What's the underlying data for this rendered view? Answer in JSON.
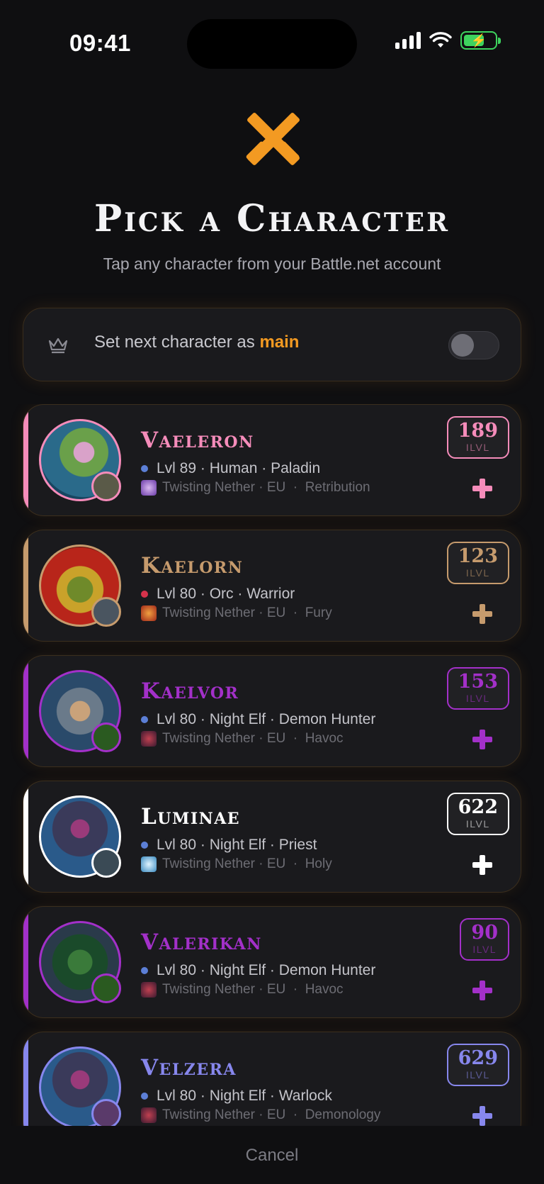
{
  "status_bar": {
    "time": "09:41"
  },
  "header": {
    "title": "Pick a Character",
    "subtitle": "Tap any character from your Battle.net account",
    "icon": "crossed-swords-icon",
    "accent_color": "#f39a22"
  },
  "main_toggle": {
    "label_prefix": "Set next character as",
    "label_highlight": "main",
    "enabled": false
  },
  "characters": [
    {
      "name": "Vaeleron",
      "level_text": "Lvl 89",
      "race": "Human",
      "class": "Paladin",
      "realm": "Twisting Nether",
      "region": "EU",
      "spec": "Retribution",
      "ilvl": "189",
      "ilvl_label": "ILVL",
      "faction_color": "#5c7fd6",
      "class_color": "#f58cba"
    },
    {
      "name": "Kaelorn",
      "level_text": "Lvl 80",
      "race": "Orc",
      "class": "Warrior",
      "realm": "Twisting Nether",
      "region": "EU",
      "spec": "Fury",
      "ilvl": "123",
      "ilvl_label": "ILVL",
      "faction_color": "#d6324b",
      "class_color": "#c69b6d"
    },
    {
      "name": "Kaelvor",
      "level_text": "Lvl 80",
      "race": "Night Elf",
      "class": "Demon Hunter",
      "realm": "Twisting Nether",
      "region": "EU",
      "spec": "Havoc",
      "ilvl": "153",
      "ilvl_label": "ILVL",
      "faction_color": "#5c7fd6",
      "class_color": "#a330c9"
    },
    {
      "name": "Luminae",
      "level_text": "Lvl 80",
      "race": "Night Elf",
      "class": "Priest",
      "realm": "Twisting Nether",
      "region": "EU",
      "spec": "Holy",
      "ilvl": "622",
      "ilvl_label": "ILVL",
      "faction_color": "#5c7fd6",
      "class_color": "#ffffff"
    },
    {
      "name": "Valerikan",
      "level_text": "Lvl 80",
      "race": "Night Elf",
      "class": "Demon Hunter",
      "realm": "Twisting Nether",
      "region": "EU",
      "spec": "Havoc",
      "ilvl": "90",
      "ilvl_label": "ILVL",
      "faction_color": "#5c7fd6",
      "class_color": "#a330c9"
    },
    {
      "name": "Velzera",
      "level_text": "Lvl 80",
      "race": "Night Elf",
      "class": "Warlock",
      "realm": "Twisting Nether",
      "region": "EU",
      "spec": "Demonology",
      "ilvl": "629",
      "ilvl_label": "ILVL",
      "faction_color": "#5c7fd6",
      "class_color": "#8787ed"
    }
  ],
  "footer": {
    "cancel_label": "Cancel"
  }
}
